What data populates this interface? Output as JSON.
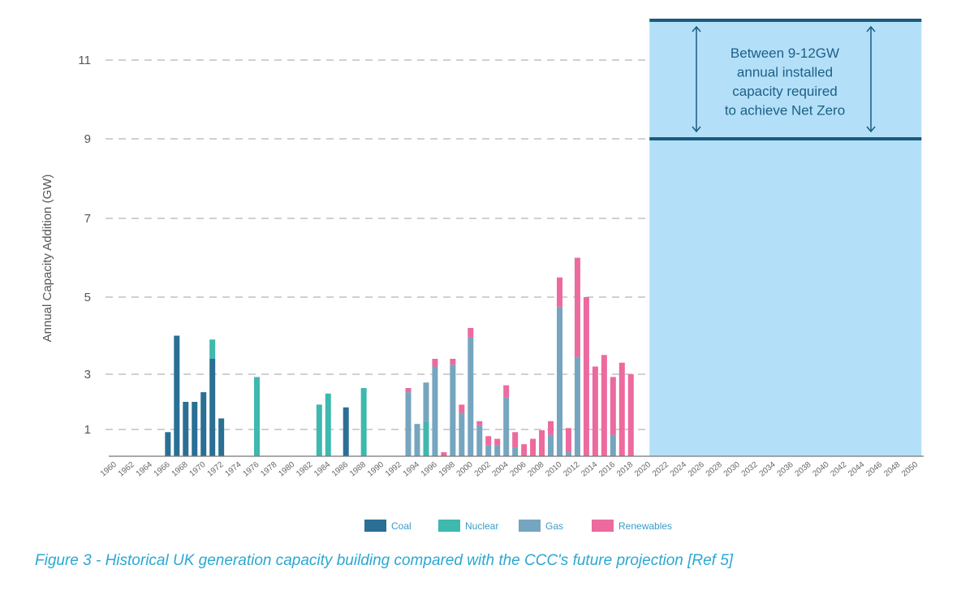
{
  "chart_data": {
    "type": "bar",
    "stacked": true,
    "ylabel": "Annual Capacity Addition (GW)",
    "xlabel": "",
    "y_ticks": [
      1,
      3,
      5,
      7,
      9,
      11
    ],
    "x_tick_labels": [
      "1960",
      "1962",
      "1964",
      "1966",
      "1968",
      "1970",
      "1972",
      "1974",
      "1976",
      "1978",
      "1980",
      "1982",
      "1984",
      "1986",
      "1988",
      "1990",
      "1992",
      "1994",
      "1996",
      "1998",
      "2000",
      "2002",
      "2004",
      "2006",
      "2008",
      "2010",
      "2012",
      "2014",
      "2016",
      "2018",
      "2020",
      "2022",
      "2024",
      "2026",
      "2028",
      "2030",
      "2032",
      "2034",
      "2036",
      "2038",
      "2040",
      "2042",
      "2044",
      "2046",
      "2048",
      "2050"
    ],
    "grid": "horizontal dashed",
    "legend_position": "bottom",
    "colors": {
      "Coal": "#2b6f94",
      "Nuclear": "#3fb8ae",
      "Gas": "#76a5bf",
      "Renewables": "#ec6a9e"
    },
    "series": [
      {
        "name": "Coal",
        "data": {
          "1966": 0.9,
          "1967": 4.0,
          "1968": 2.0,
          "1969": 2.0,
          "1970": 2.35,
          "1971": 3.4,
          "1972": 1.4,
          "1986": 1.8
        }
      },
      {
        "name": "Nuclear",
        "data": {
          "1971": 0.5,
          "1976": 2.9,
          "1983": 1.9,
          "1984": 2.3,
          "1988": 2.5,
          "1995": 1.3
        }
      },
      {
        "name": "Gas",
        "data": {
          "1993": 2.35,
          "1994": 1.2,
          "1995": 1.4,
          "1996": 3.2,
          "1998": 3.25,
          "1999": 1.6,
          "2000": 3.95,
          "2001": 1.15,
          "2002": 0.4,
          "2003": 0.4,
          "2004": 2.15,
          "2005": 0.33,
          "2009": 0.8,
          "2010": 4.75,
          "2011": 0.15,
          "2012": 3.45,
          "2016": 0.8
        }
      },
      {
        "name": "Renewables",
        "data": {
          "1993": 0.15,
          "1996": 0.2,
          "1997": 0.15,
          "1998": 0.15,
          "1999": 0.3,
          "2000": 0.25,
          "2001": 0.15,
          "2002": 0.35,
          "2003": 0.25,
          "2004": 0.45,
          "2005": 0.57,
          "2006": 0.45,
          "2007": 0.65,
          "2008": 0.97,
          "2009": 0.5,
          "2010": 0.75,
          "2011": 0.9,
          "2012": 2.55,
          "2013": 5.0,
          "2014": 3.2,
          "2015": 3.5,
          "2016": 2.1,
          "2017": 3.3,
          "2018": 3.0
        }
      }
    ],
    "projection": {
      "x_range": [
        2020,
        2050
      ],
      "y_range": [
        9,
        12
      ],
      "fill_color": "#b3e0f8",
      "line_color": "#1b5a7f",
      "annotation": [
        "Between 9-12GW",
        "annual installed",
        "capacity required",
        "to achieve Net Zero"
      ]
    }
  },
  "caption": "Figure 3 - Historical UK generation capacity building compared with the CCC's future projection [Ref 5]"
}
